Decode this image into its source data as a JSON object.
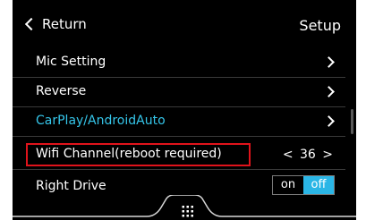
{
  "header": {
    "back_label": "Return",
    "title": "Setup"
  },
  "items": [
    {
      "label": "Mic Setting"
    },
    {
      "label": "Reverse"
    },
    {
      "label": "CarPlay/AndroidAuto"
    },
    {
      "label": "Wifi Channel(reboot required)",
      "value": "< 36 >"
    },
    {
      "label": "Right Drive",
      "toggle_on": "on",
      "toggle_off": "off"
    }
  ],
  "colors": {
    "accent": "#35c6ea",
    "highlight": "#e0131b",
    "toggle_active": "#2ab6e6"
  },
  "icons": {
    "back": "chevron-left-icon",
    "menu": "grid-menu-icon"
  }
}
